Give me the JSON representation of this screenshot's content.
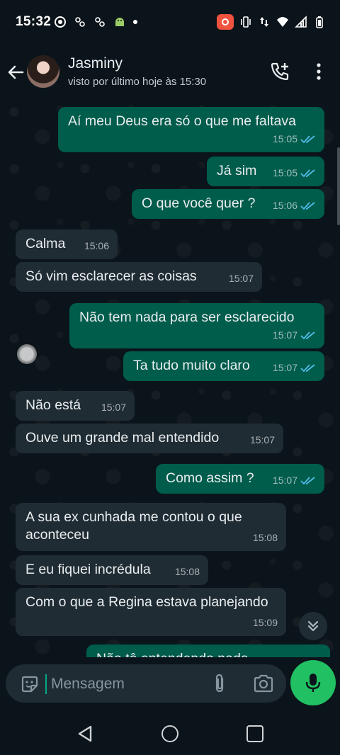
{
  "status_bar": {
    "time": "15:32",
    "icons_left": [
      "focus-icon",
      "app-icon-1",
      "app-icon-2",
      "android-icon",
      "notification-dot"
    ],
    "icons_right": [
      "screen-record-icon",
      "vibrate-icon",
      "data-arrows-icon",
      "wifi-icon",
      "signal-icon",
      "battery-icon"
    ]
  },
  "header": {
    "contact_name": "Jasminy",
    "contact_status": "visto por último hoje às 15:30",
    "icons": [
      "back-arrow-icon",
      "add-call-icon",
      "more-vert-icon"
    ]
  },
  "messages": [
    {
      "dir": "out",
      "text": "Aí meu Deus era só o que me faltava",
      "time": "15:05",
      "read": true
    },
    {
      "dir": "out",
      "text": "Já sim",
      "time": "15:05",
      "read": true
    },
    {
      "dir": "out",
      "text": "O que você quer ?",
      "time": "15:06",
      "read": true
    },
    {
      "dir": "in",
      "text": "Calma",
      "time": "15:06"
    },
    {
      "dir": "in",
      "text": "Só vim esclarecer as coisas",
      "time": "15:07"
    },
    {
      "dir": "out",
      "text": "Não tem nada para ser esclarecido",
      "time": "15:07",
      "read": true
    },
    {
      "dir": "out",
      "text": "Ta tudo muito claro",
      "time": "15:07",
      "read": true
    },
    {
      "dir": "in",
      "text": "Não está",
      "time": "15:07"
    },
    {
      "dir": "in",
      "text": "Ouve um grande mal entendido",
      "time": "15:07"
    },
    {
      "dir": "out",
      "text": "Como assim ?",
      "time": "15:07",
      "read": true
    },
    {
      "dir": "in",
      "text": "A  sua ex cunhada me  contou o que aconteceu",
      "time": "15:08"
    },
    {
      "dir": "in",
      "text": "E eu fiquei incrédula",
      "time": "15:08"
    },
    {
      "dir": "in",
      "text": "Com o que a Regina estava planejando",
      "time": "15:09"
    },
    {
      "dir": "out",
      "text": "Não tô entendendo nada",
      "time": "",
      "read": false
    }
  ],
  "composer": {
    "placeholder": "Mensagem",
    "icons": [
      "sticker-icon",
      "attach-icon",
      "camera-icon",
      "mic-icon"
    ]
  },
  "colors": {
    "background": "#0b141a",
    "outgoing_bubble": "#005c4b",
    "incoming_bubble": "#202c33",
    "read_ticks": "#53bdeb",
    "mic_button": "#21c063"
  }
}
